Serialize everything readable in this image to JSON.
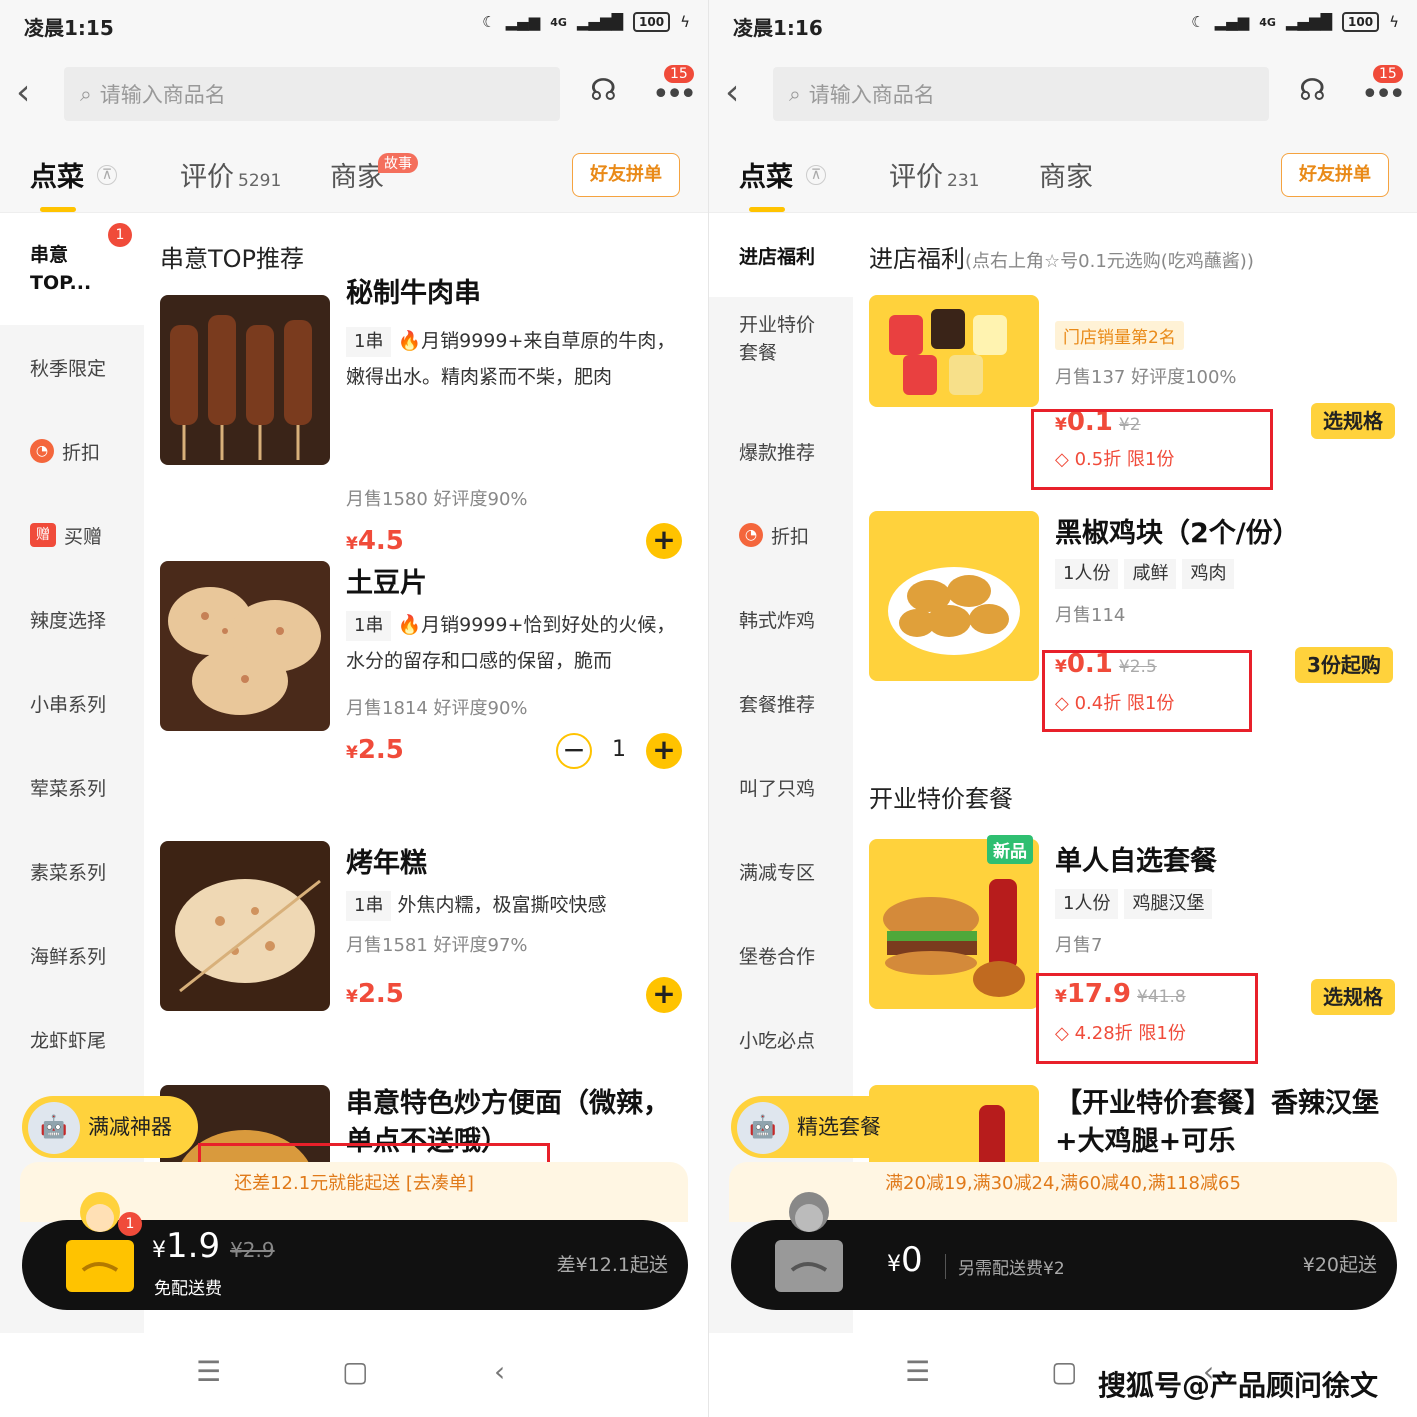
{
  "left": {
    "status": {
      "time": "凌晨1:15",
      "network": "4G",
      "battery": "100"
    },
    "search": {
      "placeholder": "请输入商品名"
    },
    "message_badge": "15",
    "tabs": [
      {
        "label": "点菜",
        "count": ""
      },
      {
        "label": "评价",
        "count": "5291"
      },
      {
        "label": "商家",
        "count": ""
      }
    ],
    "story_badge": "故事",
    "friend_button": "好友拼单",
    "sidebar": [
      {
        "label": "串意TOP...",
        "badge": "1"
      },
      {
        "label": "秋季限定"
      },
      {
        "label": "折扣",
        "icon": "discount-icon"
      },
      {
        "label": "买赠",
        "icon": "gift-icon",
        "icon_text": "赠"
      },
      {
        "label": "辣度选择"
      },
      {
        "label": "小串系列"
      },
      {
        "label": "荤菜系列"
      },
      {
        "label": "素菜系列"
      },
      {
        "label": "海鲜系列"
      },
      {
        "label": "龙虾虾尾"
      }
    ],
    "section_title": "串意TOP推荐",
    "items": [
      {
        "name": "秘制牛肉串",
        "unit": "1串",
        "desc": "🔥月销9999+来自草原的牛肉，嫩得出水。精肉紧而不柴，肥肉",
        "sales": "月售1580  好评度90%",
        "price": "4.5"
      },
      {
        "name": "土豆片",
        "unit": "1串",
        "desc": "🔥月销9999+恰到好处的火候，水分的留存和口感的保留，脆而",
        "sales": "月售1814  好评度90%",
        "price": "2.5",
        "qty": "1"
      },
      {
        "name": "烤年糕",
        "unit": "1串",
        "desc": "外焦内糯，极富撕咬快感",
        "sales": "月售1581  好评度97%",
        "price": "2.5"
      },
      {
        "name": "串意特色炒方便面（微辣，单点不送哦）"
      }
    ],
    "pill": "满减神器",
    "promo": "还差12.1元就能起送 [去凑单]",
    "cart": {
      "total": "1.9",
      "original": "¥2.9",
      "delivery": "免配送费",
      "need": "差¥12.1起送",
      "badge": "1"
    },
    "currency": "¥"
  },
  "right": {
    "status": {
      "time": "凌晨1:16",
      "network": "4G",
      "battery": "100"
    },
    "search": {
      "placeholder": "请输入商品名"
    },
    "message_badge": "15",
    "tabs": [
      {
        "label": "点菜",
        "count": ""
      },
      {
        "label": "评价",
        "count": "231"
      },
      {
        "label": "商家",
        "count": ""
      }
    ],
    "friend_button": "好友拼单",
    "sidebar": [
      {
        "label": "进店福利"
      },
      {
        "label": "开业特价套餐"
      },
      {
        "label": "爆款推荐"
      },
      {
        "label": "折扣",
        "icon": "discount-icon"
      },
      {
        "label": "韩式炸鸡"
      },
      {
        "label": "套餐推荐"
      },
      {
        "label": "叫了只鸡"
      },
      {
        "label": "满减专区"
      },
      {
        "label": "堡卷合作"
      },
      {
        "label": "小吃必点"
      }
    ],
    "section_title": "进店福利",
    "section_note": "(点右上角☆号0.1元选购(吃鸡蘸酱))",
    "section2_title": "开业特价套餐",
    "items": [
      {
        "hot": "门店销量第2名",
        "sales": "月售137  好评度100%",
        "price": "0.1",
        "original": "¥2",
        "discount": "0.5折  限1份",
        "action": "选规格"
      },
      {
        "name": "黑椒鸡块（2个/份）",
        "tags": [
          "1人份",
          "咸鲜",
          "鸡肉"
        ],
        "sales": "月售114",
        "price": "0.1",
        "original": "¥2.5",
        "discount": "0.4折  限1份",
        "action": "3份起购"
      },
      {
        "name": "单人自选套餐",
        "new": "新品",
        "tags": [
          "1人份",
          "鸡腿汉堡"
        ],
        "sales": "月售7",
        "price": "17.9",
        "original": "¥41.8",
        "discount": "4.28折  限1份",
        "action": "选规格"
      },
      {
        "name": "【开业特价套餐】香辣汉堡+大鸡腿+可乐"
      }
    ],
    "pill": "精选套餐",
    "promo": "满20减19,满30减24,满60减40,满118减65",
    "cart": {
      "total": "0",
      "delivery": "另需配送费¥2",
      "need": "¥20起送"
    },
    "currency": "¥"
  },
  "watermark": "搜狐号@产品顾问徐文"
}
